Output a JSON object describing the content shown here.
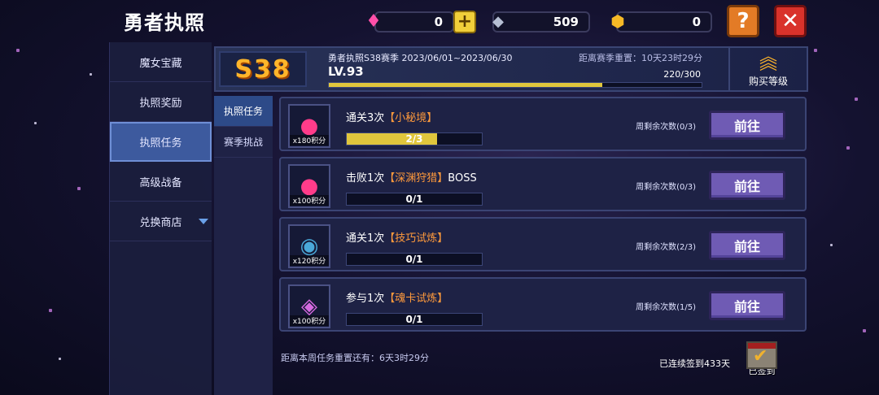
{
  "app": {
    "title": "勇者执照"
  },
  "resources": [
    {
      "icon": "pink-gem-icon",
      "value": "0"
    },
    {
      "icon": "silver-crystal-icon",
      "value": "509"
    },
    {
      "icon": "gold-gem-icon",
      "value": "0"
    }
  ],
  "buttons": {
    "plus": "+",
    "help": "?",
    "close": "✕"
  },
  "sidebar": {
    "items": [
      {
        "label": "魔女宝藏",
        "active": false
      },
      {
        "label": "执照奖励",
        "active": false
      },
      {
        "label": "执照任务",
        "active": true
      },
      {
        "label": "高级战备",
        "active": false
      },
      {
        "label": "兑换商店",
        "active": false,
        "has_dropdown": true
      }
    ]
  },
  "subtabs": [
    {
      "label": "执照任务",
      "active": true
    },
    {
      "label": "赛季挑战",
      "active": false
    }
  ],
  "season": {
    "badge": "S38",
    "name": "勇者执照S38赛季 2023/06/01~2023/06/30",
    "countdown": "距离赛季重置：10天23时29分",
    "level": "LV.93",
    "exp_text": "220/300",
    "exp_progress": 0.733,
    "buy_level_label": "购买等级"
  },
  "tasks": [
    {
      "icon": "pink-monster-icon",
      "points": "x180积分",
      "title_prefix": "通关3次",
      "title_highlight": "【小秘境】",
      "title_suffix": "",
      "progress_text": "2/3",
      "progress": 0.667,
      "remaining": "周剩余次数(0/3)",
      "button": "前往"
    },
    {
      "icon": "pink-monster-icon",
      "points": "x100积分",
      "title_prefix": "击败1次",
      "title_highlight": "【深渊狩猎】",
      "title_suffix": "BOSS",
      "progress_text": "0/1",
      "progress": 0,
      "remaining": "周剩余次数(0/3)",
      "button": "前往"
    },
    {
      "icon": "blue-orb-icon",
      "points": "x120积分",
      "title_prefix": "通关1次",
      "title_highlight": "【技巧试炼】",
      "title_suffix": "",
      "progress_text": "0/1",
      "progress": 0,
      "remaining": "周剩余次数(2/3)",
      "button": "前往"
    },
    {
      "icon": "purple-card-icon",
      "points": "x100积分",
      "title_prefix": "参与1次",
      "title_highlight": "【魂卡试炼】",
      "title_suffix": "",
      "progress_text": "0/1",
      "progress": 0,
      "remaining": "周剩余次数(1/5)",
      "button": "前往"
    }
  ],
  "footer": {
    "weekly_reset": "距离本周任务重置还有：6天3时29分",
    "checkin_days": "已连续签到433天",
    "checkin_label": "已签到"
  }
}
